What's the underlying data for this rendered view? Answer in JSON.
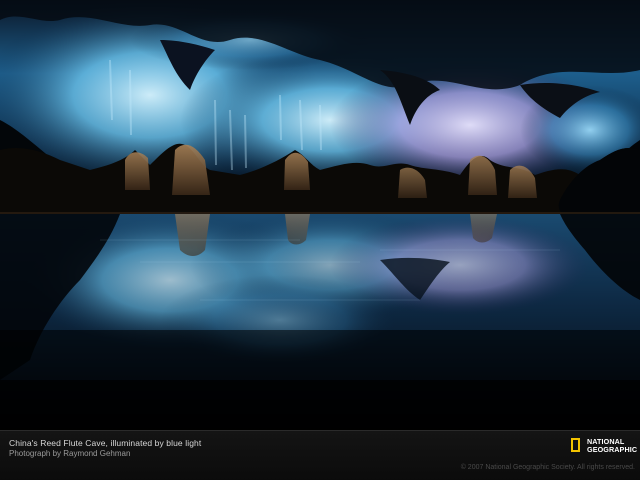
{
  "caption": {
    "title": "China's Reed Flute Cave, illuminated by blue light",
    "credit": "Photograph by Raymond Gehman"
  },
  "logo": {
    "line1": "NATIONAL",
    "line2": "GEOGRAPHIC",
    "frame_color": "#f3c300"
  },
  "copyright": "© 2007 National Geographic Society. All rights reserved.",
  "colors": {
    "cave_blue": "#6fc8f0",
    "cave_violet": "#b8a6e8",
    "rock_amber": "#7a5a38",
    "caption_bg": "#141414"
  }
}
